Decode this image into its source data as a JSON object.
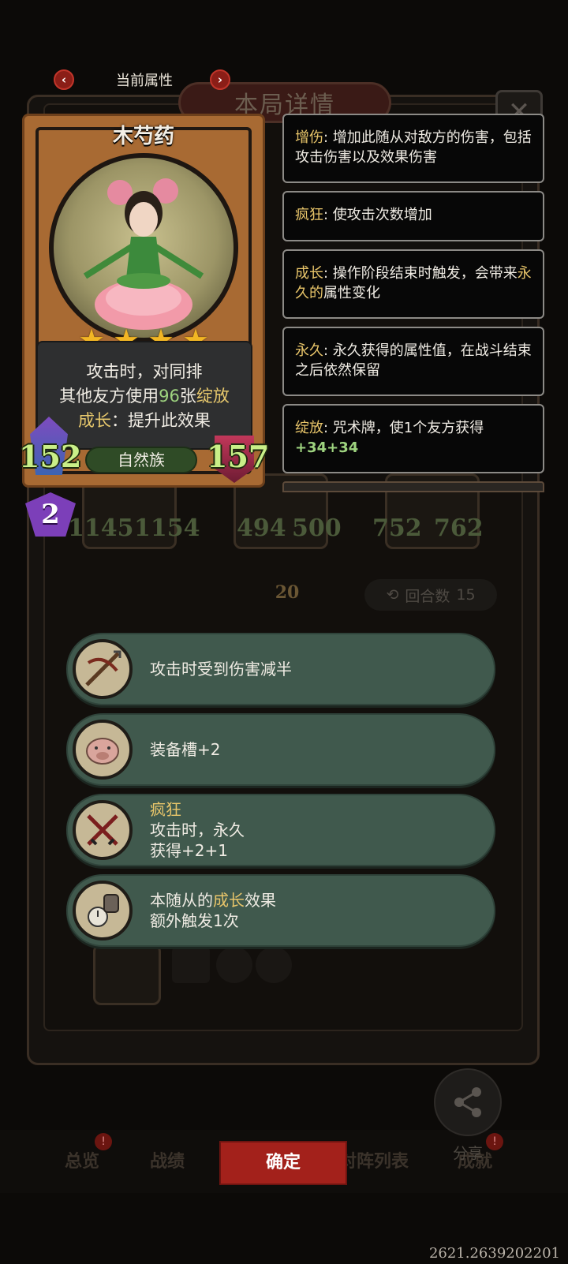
{
  "header": {
    "title": "当前属性",
    "prev_icon": "chevron-left-icon",
    "next_icon": "chevron-right-icon"
  },
  "background": {
    "panel_title": "本局详情",
    "close_icon": "close-icon",
    "stats": [
      "1145",
      "1154",
      "494",
      "500",
      "752",
      "762"
    ],
    "round_label": "回合数",
    "round_value": "15",
    "arrow_value": "20"
  },
  "card": {
    "name": "木芍药",
    "stars": 4,
    "desc_line1": "攻击时，对同排",
    "desc_line2_a": "其他友方使用",
    "desc_line2_num": "96",
    "desc_line2_b": "张",
    "desc_line2_kw": "绽放",
    "desc_line3_kw": "成长",
    "desc_line3_b": "：提升此效果",
    "attack": "152",
    "health": "157",
    "tribe": "自然族",
    "level": "2"
  },
  "tooltips": [
    {
      "keyword": "增伤",
      "text": ": 增加此随从对敌方的伤害，包括攻击伤害以及效果伤害"
    },
    {
      "keyword": "疯狂",
      "text": ": 使攻击次数增加"
    },
    {
      "keyword": "成长",
      "text_a": ": 操作阶段结束时触发，会带来",
      "keyword2": "永久的",
      "text_b": "属性变化"
    },
    {
      "keyword": "永久",
      "text": ": 永久获得的属性值，在战斗结束之后依然保留"
    },
    {
      "keyword": "绽放",
      "text": ": 咒术牌，使1个友方获得",
      "bonus": "+34+34"
    }
  ],
  "effects": [
    {
      "icon": "crossbow-icon",
      "line1": "攻击时受到伤害减半"
    },
    {
      "icon": "pig-icon",
      "line1": "装备槽+2"
    },
    {
      "icon": "crossed-swords-icon",
      "title": "疯狂",
      "line1": "攻击时，永久",
      "line2": "获得+2+1"
    },
    {
      "icon": "gauntlet-stopwatch-icon",
      "line1_a": "本随从的",
      "line1_kw": "成长",
      "line1_b": "效果",
      "line2": "额外触发1次"
    }
  ],
  "bottom": {
    "confirm": "确定",
    "share": "分享",
    "tabs": [
      "总览",
      "战绩",
      "对阵列表",
      "成就"
    ]
  },
  "version": "2621.2639202201",
  "colors": {
    "accent_red": "#a3211b",
    "keyword_gold": "#e8c56a",
    "number_green": "#9ed37f",
    "effect_bg": "#40594d"
  }
}
